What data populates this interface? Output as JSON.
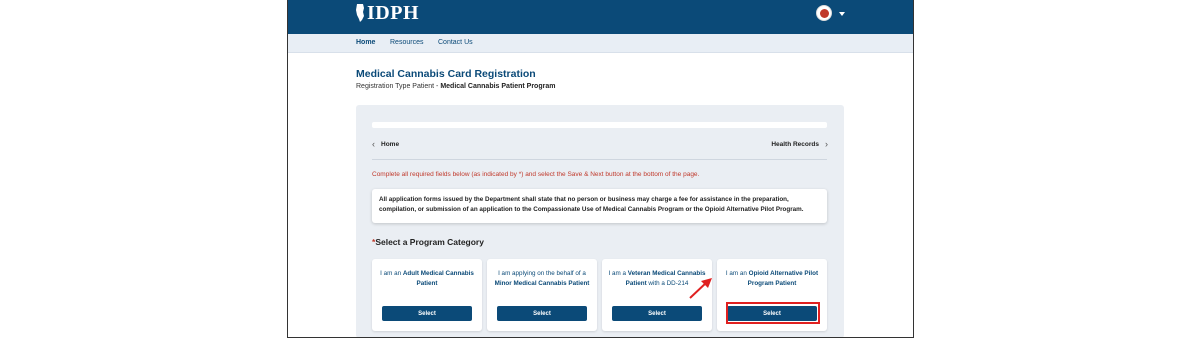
{
  "header": {
    "logo_text": "IDPH",
    "avatar_icon": "user-avatar-icon",
    "menu_caret_icon": "chevron-down-icon",
    "bar_color": "#0b4a78"
  },
  "nav": {
    "home": "Home",
    "resources": "Resources",
    "contact": "Contact Us"
  },
  "page": {
    "title": "Medical Cannabis Card Registration",
    "registration_type_prefix": "Registration Type Patient - ",
    "registration_type_value": "Medical Cannabis Patient Program"
  },
  "breadcrumb": {
    "left": "Home",
    "right": "Health Records"
  },
  "required_note": "Complete all required fields below (as indicated by *) and select the Save & Next button at the bottom of the page.",
  "notice": "All application forms issued by the Department shall state that no person or business may charge a fee for assistance in the preparation, compilation, or submission of an application to the Compassionate Use of Medical Cannabis Program or the Opioid Alternative Pilot Program.",
  "section": {
    "required_star": "*",
    "title": "Select a Program Category"
  },
  "options": [
    {
      "prefix": "I am an ",
      "bold": "Adult Medical Cannabis Patient",
      "suffix": "",
      "button": "Select"
    },
    {
      "prefix": "I am applying on the behalf of a ",
      "bold": "Minor Medical Cannabis Patient",
      "suffix": "",
      "button": "Select"
    },
    {
      "prefix": "I am a ",
      "bold": "Veteran Medical Cannabis Patient",
      "suffix": " with a DD-214",
      "button": "Select"
    },
    {
      "prefix": "I am an ",
      "bold": "Opioid Alternative Pilot Program Patient",
      "suffix": "",
      "button": "Select"
    }
  ],
  "annotation": {
    "highlight_color": "#e02020",
    "arrow_icon": "red-arrow-icon"
  }
}
